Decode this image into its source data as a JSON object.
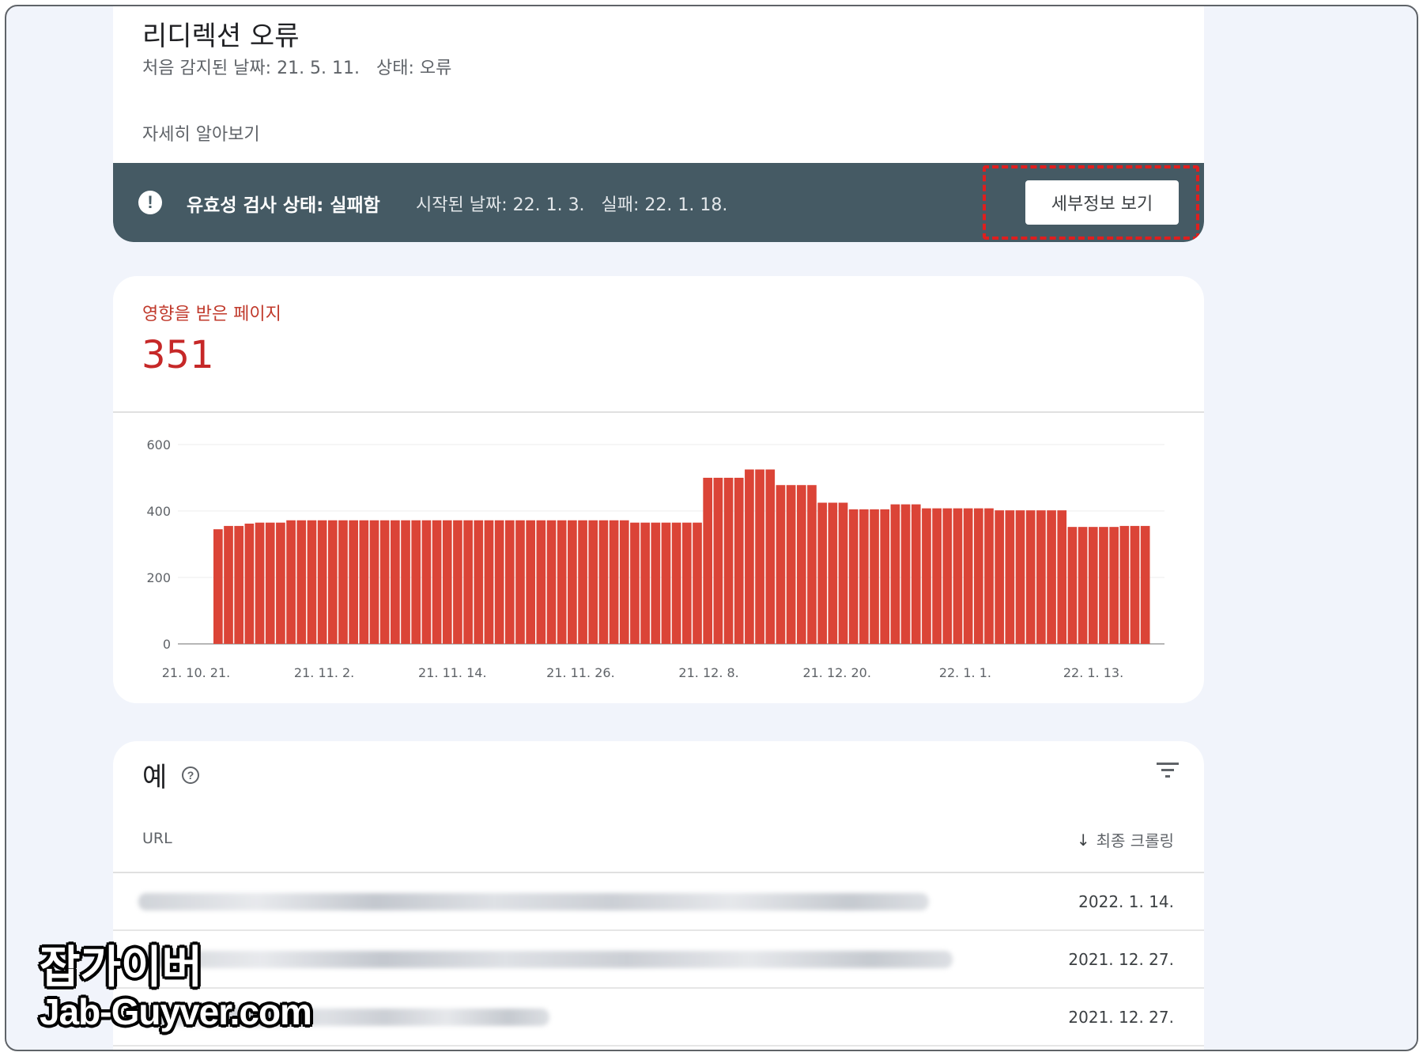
{
  "issue": {
    "title": "리디렉션 오류",
    "meta": "처음 감지된 날짜: 21. 5. 11.   상태: 오류",
    "learn_more": "자세히 알아보기"
  },
  "validation": {
    "label": "유효성 검사 상태: 실패함",
    "detail": "시작된 날짜: 22. 1. 3.   실패: 22. 1. 18.",
    "button_label": "세부정보 보기",
    "icon": "alert-icon",
    "icon_glyph": "!"
  },
  "affected": {
    "label": "영향을 받은 페이지",
    "value": "351"
  },
  "chart_data": {
    "type": "bar",
    "ylim": [
      0,
      600
    ],
    "yticks": [
      "0",
      "200",
      "400",
      "600"
    ],
    "xtick_labels": [
      "21. 10. 21.",
      "21. 11. 2.",
      "21. 11. 14.",
      "21. 11. 26.",
      "21. 12. 8.",
      "21. 12. 20.",
      "22. 1. 1.",
      "22. 1. 13."
    ],
    "values": [
      345,
      355,
      355,
      362,
      365,
      365,
      365,
      372,
      372,
      372,
      372,
      372,
      372,
      372,
      372,
      372,
      372,
      372,
      372,
      372,
      372,
      372,
      372,
      372,
      372,
      372,
      372,
      372,
      372,
      372,
      372,
      372,
      372,
      372,
      372,
      372,
      372,
      372,
      372,
      372,
      365,
      365,
      365,
      365,
      365,
      365,
      365,
      500,
      500,
      500,
      500,
      525,
      525,
      525,
      478,
      478,
      478,
      478,
      425,
      425,
      425,
      405,
      405,
      405,
      405,
      420,
      420,
      420,
      408,
      408,
      408,
      408,
      408,
      408,
      408,
      402,
      402,
      402,
      402,
      402,
      402,
      402,
      352,
      352,
      352,
      352,
      352,
      355,
      355,
      355
    ],
    "grid": true,
    "color": "#db4437"
  },
  "examples": {
    "title": "예",
    "help_icon": "help-icon",
    "filter_icon": "filter-icon",
    "col_url": "URL",
    "col_crawl": "최종 크롤링",
    "sort_arrow": "↓",
    "rows": [
      {
        "date": "2022. 1. 14."
      },
      {
        "date": "2021. 12. 27."
      },
      {
        "date": "2021. 12. 27."
      }
    ]
  },
  "watermark": {
    "korean": "잡가이버",
    "english": "Jab-Guyver.com"
  }
}
